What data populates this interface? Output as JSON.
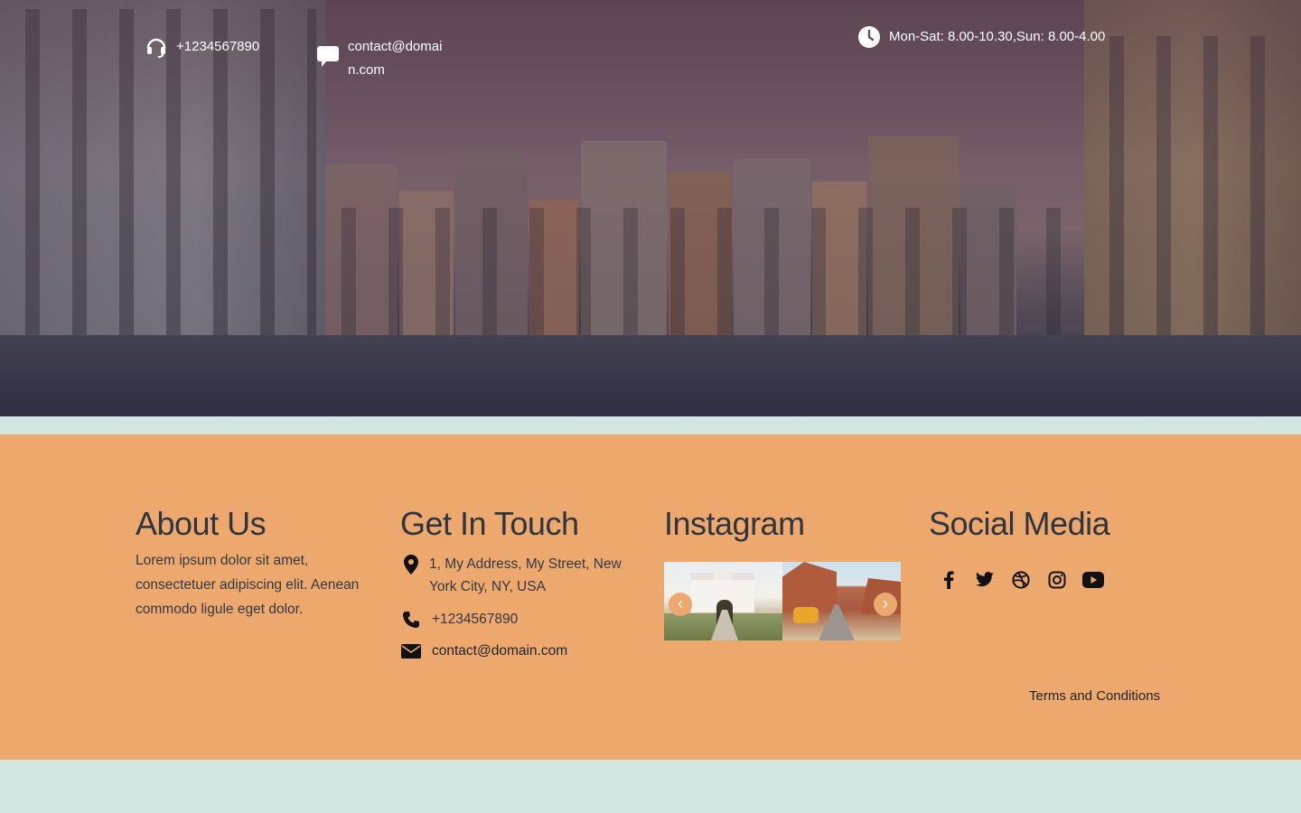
{
  "topbar": {
    "phone": "+1234567890",
    "email": "contact@domain.com",
    "hours": "Mon-Sat: 8.00-10.30,Sun: 8.00-4.00"
  },
  "footer": {
    "about": {
      "title": "About Us",
      "text": "Lorem ipsum dolor sit amet, consectetuer adipiscing elit. Aenean commodo ligule eget dolor."
    },
    "contact": {
      "title": "Get In Touch",
      "address": "1, My Address, My Street, New York City, NY, USA",
      "phone": "+1234567890",
      "email": "contact@domain.com"
    },
    "instagram": {
      "title": "Instagram",
      "prev_icon": "chevron-left-icon",
      "next_icon": "chevron-right-icon"
    },
    "social": {
      "title": "Social Media",
      "icons": [
        "facebook-icon",
        "twitter-icon",
        "dribbble-icon",
        "instagram-icon",
        "youtube-icon"
      ]
    },
    "terms": "Terms and Conditions"
  },
  "colors": {
    "footer_bg": "#eca86d",
    "band_bg": "#d3e6e1",
    "heading": "#2e3440",
    "text": "#333944"
  }
}
